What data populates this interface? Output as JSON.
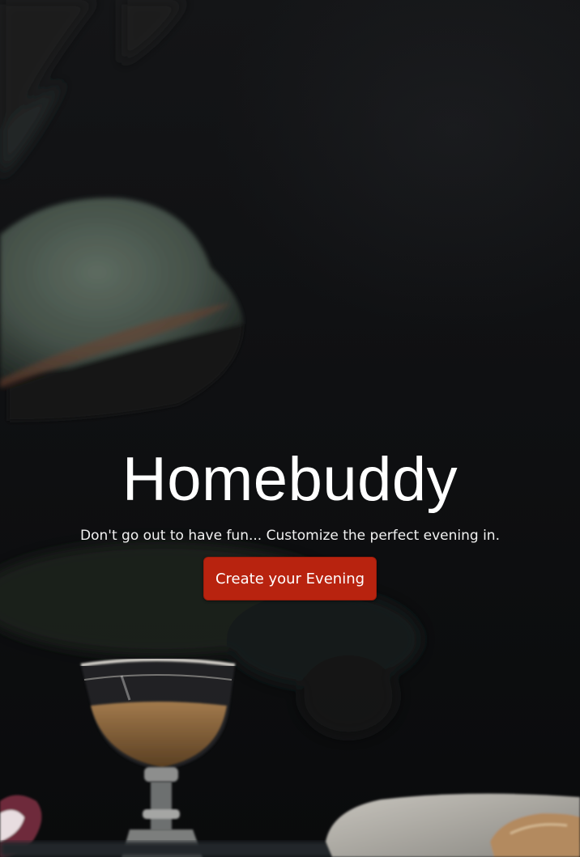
{
  "hero": {
    "title": "Homebuddy",
    "tagline": "Don't go out to have fun... Customize the perfect evening in.",
    "cta_label": "Create your Evening"
  },
  "colors": {
    "background": "#0d0e10",
    "cta": "#b8230f",
    "text": "#ffffff"
  }
}
